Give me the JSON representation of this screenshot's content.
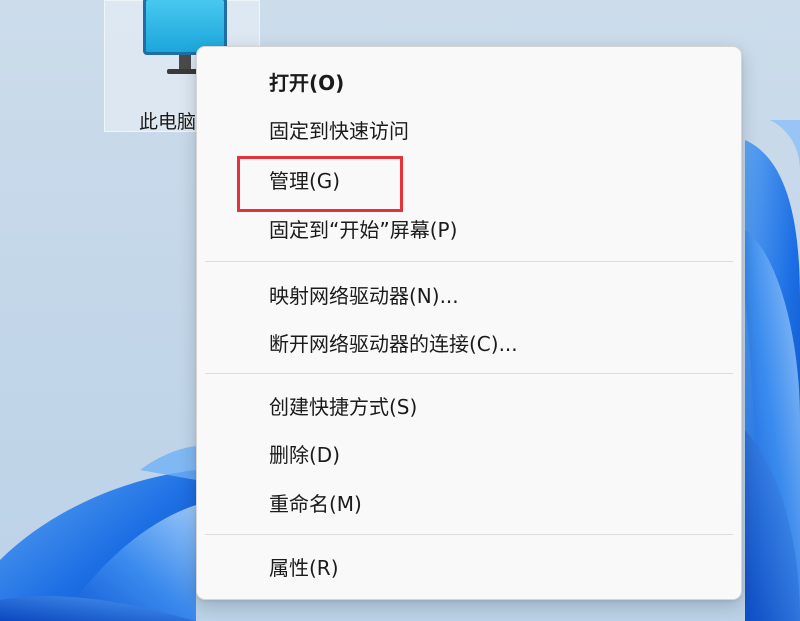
{
  "desktop": {
    "icon_label": "此电脑",
    "icon_name": "monitor-icon"
  },
  "context_menu": {
    "items": [
      {
        "label": "打开(O)"
      },
      {
        "label": "固定到快速访问"
      },
      {
        "label": "管理(G)"
      },
      {
        "label": "固定到“开始”屏幕(P)"
      },
      {
        "label": "映射网络驱动器(N)..."
      },
      {
        "label": "断开网络驱动器的连接(C)..."
      },
      {
        "label": "创建快捷方式(S)"
      },
      {
        "label": "删除(D)"
      },
      {
        "label": "重命名(M)"
      },
      {
        "label": "属性(R)"
      }
    ],
    "highlighted_item": "管理(G)"
  },
  "colors": {
    "highlight_border": "#e8323b",
    "menu_background": "#f9f9f9",
    "wallpaper_accent": "#1565e0"
  }
}
